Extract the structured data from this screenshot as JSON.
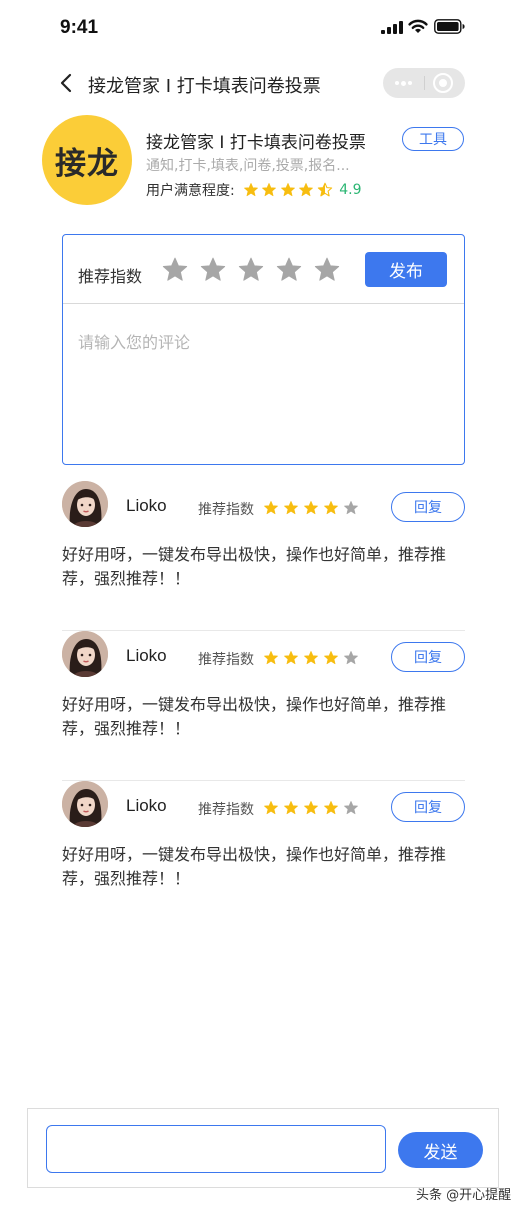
{
  "status_bar": {
    "time": "9:41"
  },
  "nav": {
    "title": "接龙管家 I 打卡填表问卷投票"
  },
  "app": {
    "logo_text": "接龙",
    "name": "接龙管家 I 打卡填表问卷投票",
    "tag": "工具",
    "keywords": "通知,打卡,填表,问卷,投票,报名...",
    "satisfaction_label": "用户满意程度:",
    "satisfaction_score": "4.9",
    "satisfaction_rating": 4.5
  },
  "rating_form": {
    "label": "推荐指数",
    "stars_total": 5,
    "stars_selected": 0,
    "publish_label": "发布",
    "placeholder": "请输入您的评论"
  },
  "comments": [
    {
      "username": "Lioko",
      "rec_label": "推荐指数",
      "rating": 4,
      "reply_label": "回复",
      "text": "好好用呀，一键发布导出极快，操作也好简单，推荐推荐，强烈推荐！！"
    },
    {
      "username": "Lioko",
      "rec_label": "推荐指数",
      "rating": 4,
      "reply_label": "回复",
      "text": "好好用呀，一键发布导出极快，操作也好简单，推荐推荐，强烈推荐！！"
    },
    {
      "username": "Lioko",
      "rec_label": "推荐指数",
      "rating": 4,
      "reply_label": "回复",
      "text": "好好用呀，一键发布导出极快，操作也好简单，推荐推荐，强烈推荐！！"
    }
  ],
  "bottom_bar": {
    "input_value": "",
    "send_label": "发送"
  },
  "watermark": "头条 @开心提醒",
  "colors": {
    "accent": "#3d78ee",
    "star_gold": "#f7bd10",
    "star_gray": "#a6a6a6",
    "score_green": "#2bb673",
    "logo_bg": "#fbcd38"
  },
  "icons": [
    "signal-icon",
    "wifi-icon",
    "battery-icon",
    "back-icon",
    "more-icon",
    "close-icon",
    "star-icon",
    "avatar"
  ]
}
